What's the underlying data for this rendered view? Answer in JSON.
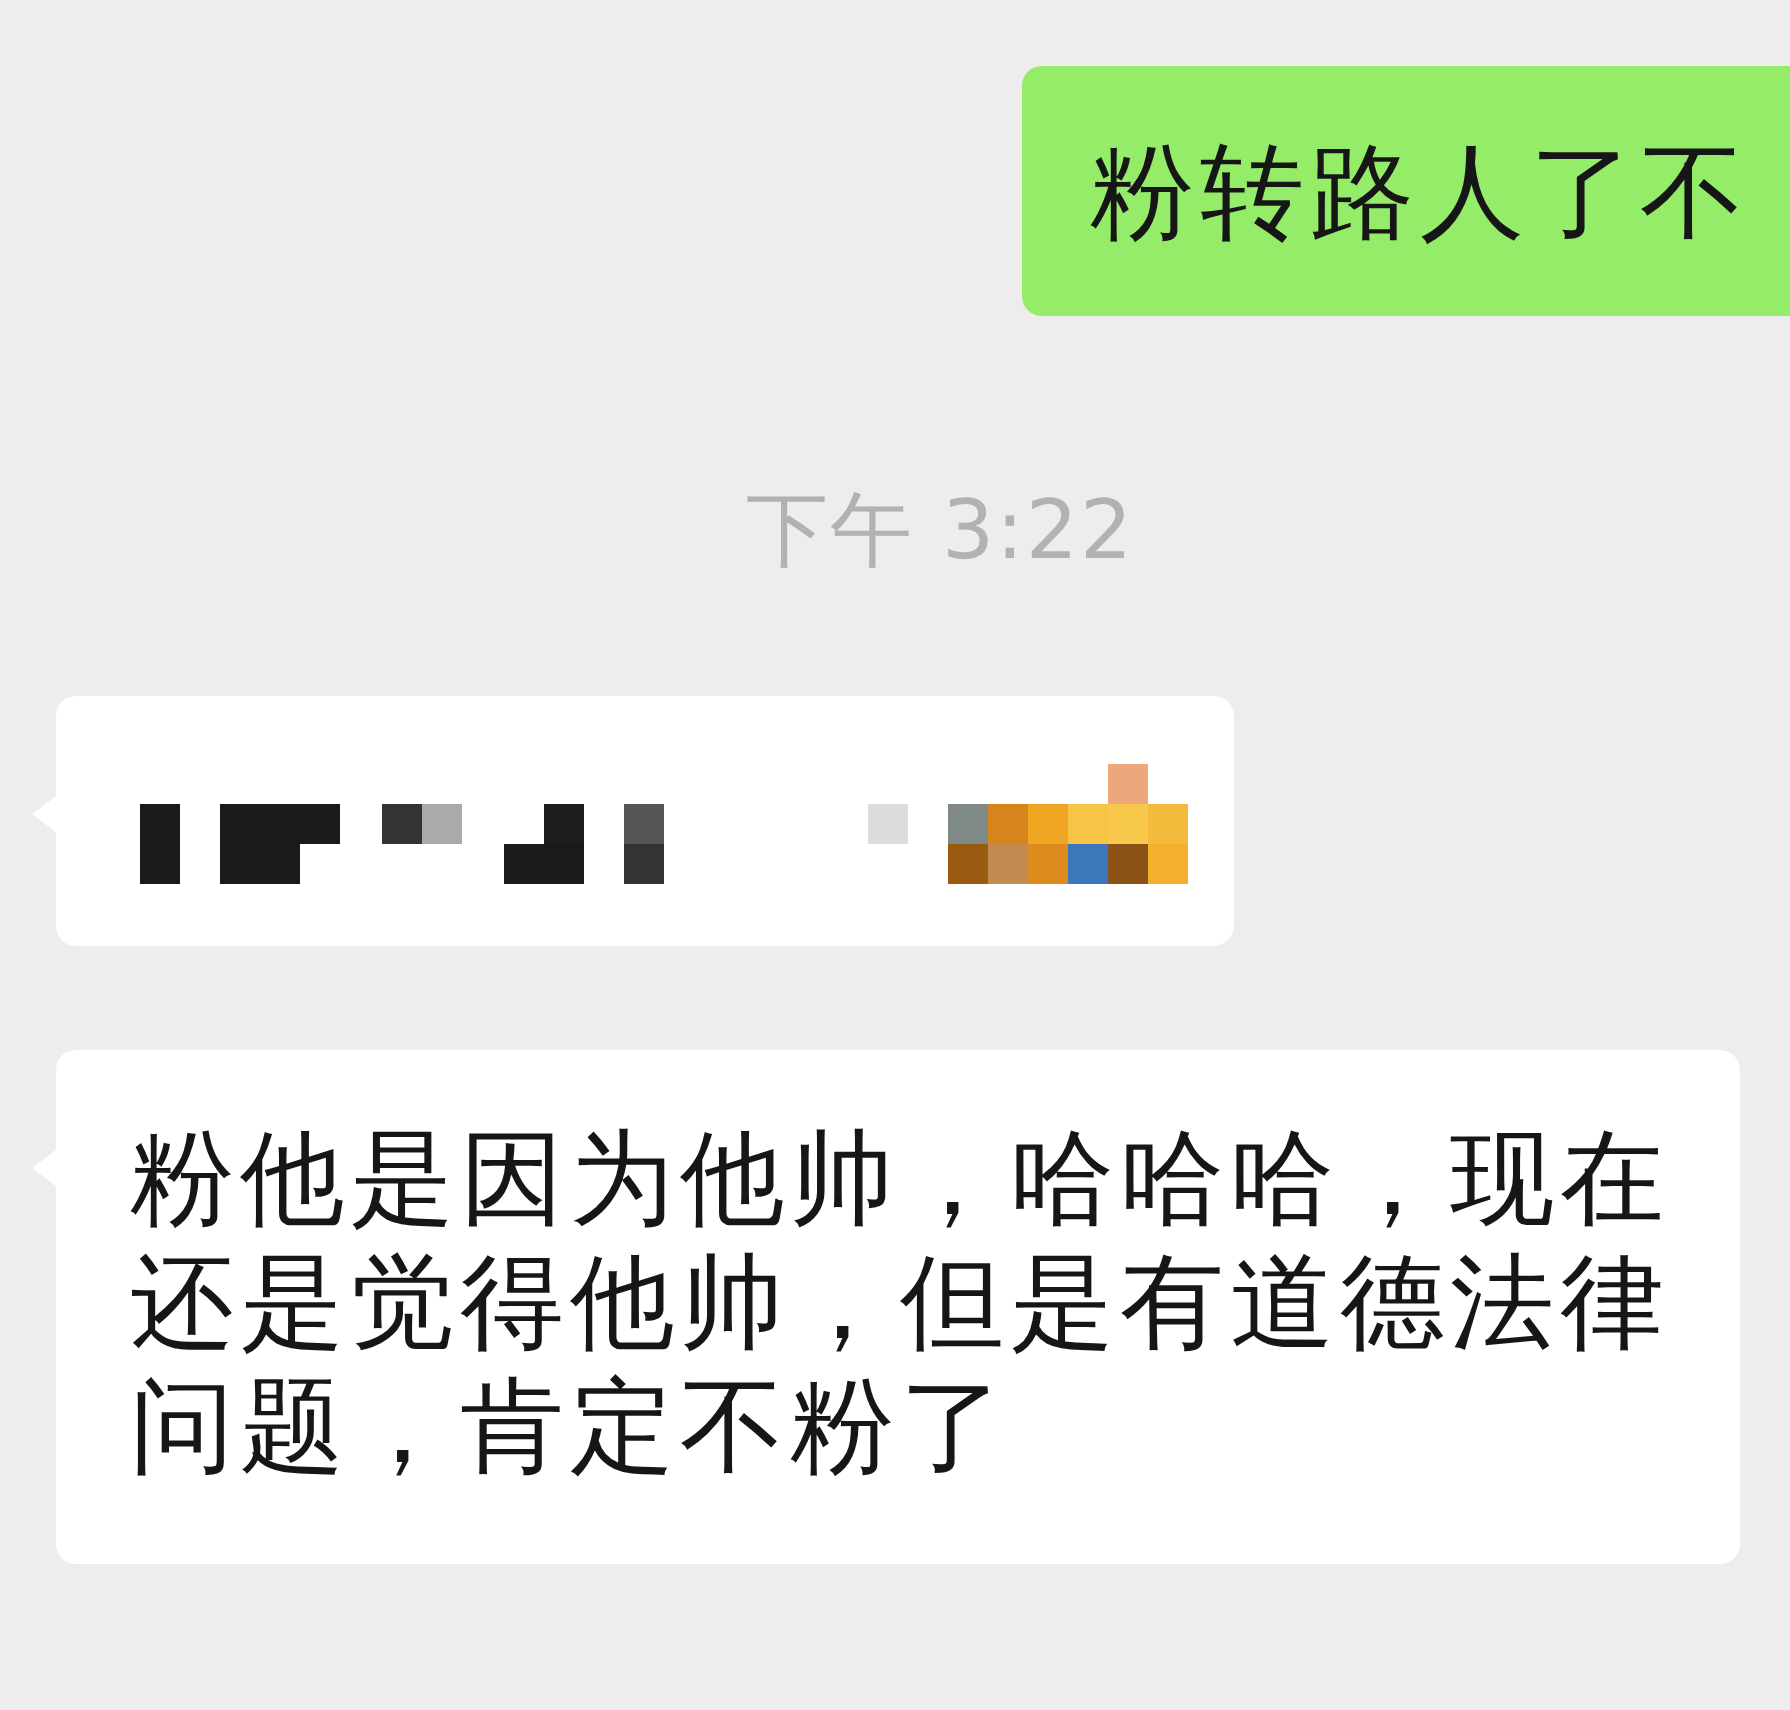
{
  "messages": [
    {
      "kind": "text",
      "sent": true,
      "text": "粉转路人了不"
    },
    {
      "kind": "timestamp",
      "text": "下午 3:22"
    },
    {
      "kind": "pixelated",
      "sent": false
    },
    {
      "kind": "text",
      "sent": false,
      "text": "粉他是因为他帅，哈哈哈，现在还是觉得他帅，但是有道德法律问题，肯定不粉了"
    }
  ]
}
